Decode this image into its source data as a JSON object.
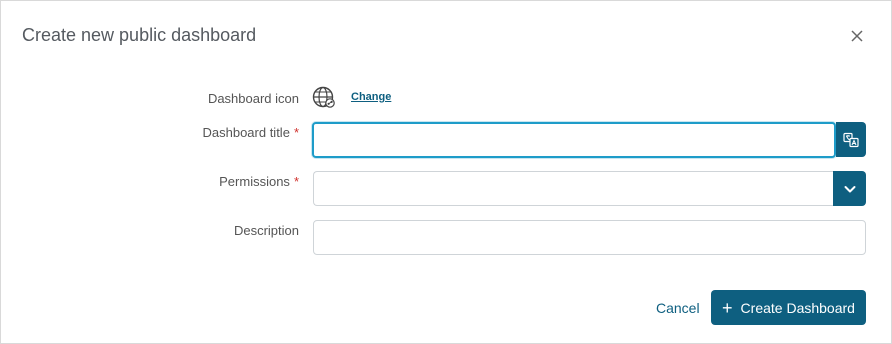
{
  "dialog": {
    "title": "Create new public dashboard",
    "close_icon": "close-icon"
  },
  "form": {
    "icon_label": "Dashboard icon",
    "icon_name": "globe-network-icon",
    "change_link": "Change",
    "title_label": "Dashboard title",
    "title_value": "",
    "translate_icon": "translate-icon",
    "permissions_label": "Permissions",
    "permissions_value": "",
    "description_label": "Description",
    "description_value": "",
    "required_marker": "*"
  },
  "footer": {
    "cancel_label": "Cancel",
    "create_label": "Create Dashboard"
  },
  "colors": {
    "primary": "#0e5f80",
    "focus_border": "#1e9cc9",
    "required": "#d0312d"
  }
}
